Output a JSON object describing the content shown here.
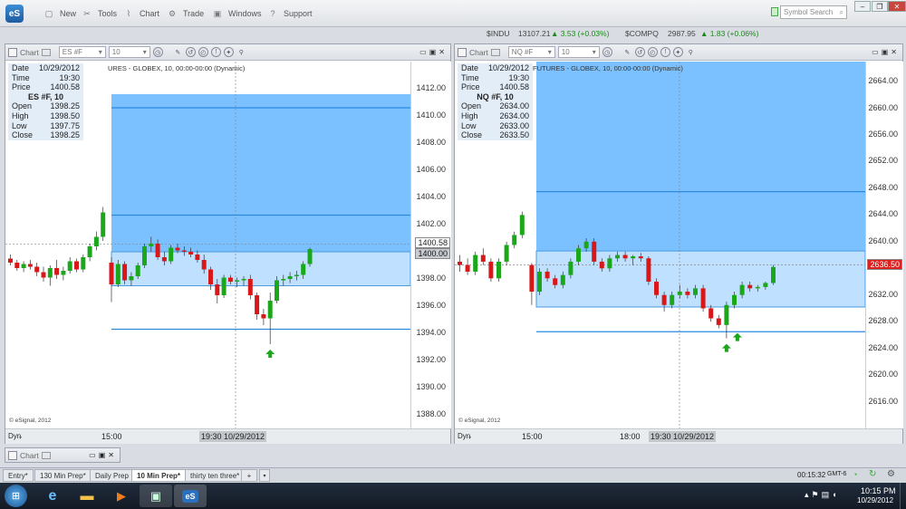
{
  "toolbar": {
    "logo": "eS",
    "items": [
      {
        "label": "New",
        "icon": "new-icon"
      },
      {
        "label": "Tools",
        "icon": "tools-icon"
      },
      {
        "label": "Chart",
        "icon": "chart-icon"
      },
      {
        "label": "Trade",
        "icon": "trade-icon"
      },
      {
        "label": "Windows",
        "icon": "windows-icon"
      },
      {
        "label": "Support",
        "icon": "support-icon"
      }
    ],
    "search_placeholder": "Symbol Search"
  },
  "ticker": [
    {
      "symbol": "$INDU",
      "value": "13107.21",
      "change": "3.53 (+0.03%)"
    },
    {
      "symbol": "$COMPQ",
      "value": "2987.95",
      "change": "1.83 (+0.06%)"
    }
  ],
  "colors": {
    "up": "#1aa81a",
    "down": "#d81818",
    "zone_dark": "#7cc1ff",
    "zone_light": "#bfe0ff"
  },
  "panels": [
    {
      "title": "Chart",
      "symbol": "ES #F",
      "interval": "10",
      "desc": "URES - GLOBEX, 10, 00:00-00:00 (Dynamic)",
      "info": {
        "date_label": "Date",
        "date": "10/29/2012",
        "time_label": "Time",
        "time": "19:30",
        "price_label": "Price",
        "price": "1400.58",
        "symbol_title": "ES #F, 10",
        "open_label": "Open",
        "open": "1398.25",
        "high_label": "High",
        "high": "1398.50",
        "low_label": "Low",
        "low": "1397.75",
        "close_label": "Close",
        "close": "1398.25"
      },
      "yticks": [
        "1412.00",
        "1410.00",
        "1408.00",
        "1406.00",
        "1404.00",
        "1402.00",
        "1400.00",
        "1398.00",
        "1396.00",
        "1394.00",
        "1392.00",
        "1390.00",
        "1388.00"
      ],
      "price_tag": "1400.58",
      "price_tag2": "1400.00",
      "xlabels": [
        "15:00"
      ],
      "cursor_label": "19:30 10/29/2012",
      "footer": "© eSignal, 2012",
      "dyn": "Dyn"
    },
    {
      "title": "Chart",
      "symbol": "NQ #F",
      "interval": "10",
      "desc": "FUTURES - GLOBEX, 10, 00:00-00:00 (Dynamic)",
      "info": {
        "date_label": "Date",
        "date": "10/29/2012",
        "time_label": "Time",
        "time": "19:30",
        "price_label": "Price",
        "price": "1400.58",
        "symbol_title": "NQ #F, 10",
        "open_label": "Open",
        "open": "2634.00",
        "high_label": "High",
        "high": "2634.00",
        "low_label": "Low",
        "low": "2633.00",
        "close_label": "Close",
        "close": "2633.50"
      },
      "yticks": [
        "2664.00",
        "2660.00",
        "2656.00",
        "2652.00",
        "2648.00",
        "2644.00",
        "2640.00",
        "2636.00",
        "2632.00",
        "2628.00",
        "2624.00",
        "2620.00",
        "2616.00"
      ],
      "price_tag": "2636.50",
      "xlabels": [
        "15:00",
        "18:00"
      ],
      "cursor_label": "19:30 10/29/2012",
      "footer": "© eSignal, 2012",
      "dyn": "Dyn"
    }
  ],
  "mini_chart": {
    "title": "Chart"
  },
  "tabs": [
    "Entry*",
    "130 Min Prep*",
    "Daily Prep",
    "10 Min Prep*",
    "thirty ten three*"
  ],
  "active_tab": "10 Min Prep*",
  "status": {
    "clock": "00:15:32",
    "tz": "GMT-6"
  },
  "taskbar": {
    "time": "10:15 PM",
    "date": "10/29/2012"
  },
  "chart_data": [
    {
      "type": "candlestick",
      "symbol": "ES #F",
      "ylim": [
        1387,
        1414
      ],
      "candles": [
        [
          1399.5,
          1399.8,
          1399,
          1399.2
        ],
        [
          1399.2,
          1399.4,
          1398.6,
          1398.8
        ],
        [
          1398.8,
          1399.3,
          1398.5,
          1399.1
        ],
        [
          1399.1,
          1399.4,
          1398.7,
          1398.9
        ],
        [
          1398.9,
          1399.2,
          1398.2,
          1398.5
        ],
        [
          1398.5,
          1398.9,
          1397.8,
          1398.1
        ],
        [
          1398.1,
          1399,
          1397.5,
          1398.8
        ],
        [
          1398.8,
          1399.4,
          1398,
          1398.3
        ],
        [
          1398.3,
          1398.9,
          1397.9,
          1398.6
        ],
        [
          1398.6,
          1399.6,
          1398.4,
          1399.3
        ],
        [
          1399.3,
          1399.5,
          1398.5,
          1398.7
        ],
        [
          1398.7,
          1399.8,
          1398.5,
          1399.6
        ],
        [
          1399.6,
          1400.6,
          1399.3,
          1400.4
        ],
        [
          1400.4,
          1401.5,
          1400.1,
          1401.1
        ],
        [
          1401.1,
          1403.3,
          1400.8,
          1402.9
        ],
        [
          1399.2,
          1399.6,
          1396.3,
          1397.6
        ],
        [
          1397.6,
          1399.4,
          1397.4,
          1399.1
        ],
        [
          1399.1,
          1399.3,
          1397.6,
          1397.9
        ],
        [
          1397.9,
          1398.5,
          1397.5,
          1398.2
        ],
        [
          1398.2,
          1399.2,
          1398,
          1399
        ],
        [
          1399,
          1400.6,
          1398.8,
          1400.4
        ],
        [
          1400.4,
          1401.1,
          1400,
          1400.6
        ],
        [
          1400.6,
          1400.9,
          1399.4,
          1399.6
        ],
        [
          1399.6,
          1400,
          1399,
          1399.3
        ],
        [
          1399.3,
          1400.5,
          1399.1,
          1400.3
        ],
        [
          1400.3,
          1400.6,
          1399.9,
          1400.1
        ],
        [
          1400.1,
          1400.4,
          1399.7,
          1400
        ],
        [
          1400,
          1400.3,
          1399.6,
          1399.8
        ],
        [
          1399.8,
          1400.1,
          1399.2,
          1399.4
        ],
        [
          1399.4,
          1399.8,
          1398.4,
          1398.7
        ],
        [
          1398.7,
          1398.9,
          1397.2,
          1397.6
        ],
        [
          1397.6,
          1398,
          1396.2,
          1396.8
        ],
        [
          1396.8,
          1398.3,
          1396.6,
          1398.1
        ],
        [
          1398.1,
          1398.3,
          1397.6,
          1397.8
        ],
        [
          1397.8,
          1398.1,
          1397.4,
          1397.9
        ],
        [
          1397.9,
          1398.2,
          1397.5,
          1398
        ],
        [
          1398,
          1398.3,
          1396.5,
          1396.8
        ],
        [
          1396.8,
          1397,
          1395,
          1395.4
        ],
        [
          1395.4,
          1395.8,
          1394.6,
          1395.1
        ],
        [
          1395.1,
          1397,
          1393.2,
          1396.4
        ],
        [
          1396.4,
          1398.2,
          1396.2,
          1397.9
        ],
        [
          1397.9,
          1398.3,
          1397.5,
          1398
        ],
        [
          1398,
          1398.5,
          1397.7,
          1398.2
        ],
        [
          1398.2,
          1398.6,
          1397.9,
          1398.3
        ],
        [
          1398.3,
          1399.3,
          1398,
          1399.1
        ],
        [
          1399.1,
          1400.3,
          1398.9,
          1400.2
        ]
      ],
      "zones": [
        {
          "from": 1400,
          "to": 1411.6
        },
        {
          "from": 1397.5,
          "to": 1400
        }
      ],
      "lines": [
        1410.6,
        1402.7,
        1394.3
      ]
    },
    {
      "type": "candlestick",
      "symbol": "NQ #F",
      "ylim": [
        2612,
        2667
      ],
      "candles": [
        [
          2637,
          2638,
          2635.5,
          2636.5
        ],
        [
          2636.5,
          2637.5,
          2635,
          2635.5
        ],
        [
          2635.5,
          2638.5,
          2635,
          2638
        ],
        [
          2638,
          2639,
          2636.5,
          2637
        ],
        [
          2637,
          2637.5,
          2634,
          2634.5
        ],
        [
          2634.5,
          2637.5,
          2634,
          2637
        ],
        [
          2637,
          2640,
          2636.5,
          2639.5
        ],
        [
          2639.5,
          2641.5,
          2639,
          2641
        ],
        [
          2641,
          2644.5,
          2640.5,
          2644
        ],
        [
          2636.5,
          2636.8,
          2630.5,
          2632.5
        ],
        [
          2632.5,
          2636,
          2632,
          2635.5
        ],
        [
          2635.5,
          2636,
          2634,
          2634.5
        ],
        [
          2634.5,
          2635,
          2633,
          2633.5
        ],
        [
          2633.5,
          2635.5,
          2633,
          2635
        ],
        [
          2635,
          2637.5,
          2634.5,
          2637
        ],
        [
          2637,
          2639.5,
          2636.5,
          2639
        ],
        [
          2639,
          2640.5,
          2638.5,
          2640
        ],
        [
          2640,
          2640.5,
          2636.5,
          2637
        ],
        [
          2637,
          2637.5,
          2635.5,
          2636
        ],
        [
          2636,
          2638,
          2635.5,
          2637.5
        ],
        [
          2637.5,
          2638.5,
          2637,
          2638
        ],
        [
          2638,
          2638.5,
          2637,
          2637.5
        ],
        [
          2637.5,
          2638,
          2636.5,
          2637.8
        ],
        [
          2637.8,
          2638.3,
          2637,
          2637.5
        ],
        [
          2637.5,
          2637.8,
          2633.5,
          2634
        ],
        [
          2634,
          2634.5,
          2631.5,
          2632
        ],
        [
          2632,
          2632.5,
          2629.5,
          2630.5
        ],
        [
          2630.5,
          2632.5,
          2630,
          2632
        ],
        [
          2632,
          2633.5,
          2631.5,
          2632.5
        ],
        [
          2632.5,
          2633,
          2631.5,
          2632
        ],
        [
          2632,
          2633.5,
          2631.5,
          2633
        ],
        [
          2633,
          2633.5,
          2629.5,
          2630
        ],
        [
          2630,
          2630.5,
          2628,
          2628.5
        ],
        [
          2628.5,
          2629,
          2627,
          2627.5
        ],
        [
          2627.5,
          2631,
          2625.5,
          2630.5
        ],
        [
          2630.5,
          2632.5,
          2630,
          2632
        ],
        [
          2632,
          2634,
          2631.5,
          2633.5
        ],
        [
          2633.5,
          2634,
          2632.5,
          2633
        ],
        [
          2633,
          2633.5,
          2632.5,
          2633.2
        ],
        [
          2633.2,
          2634,
          2632.8,
          2633.8
        ],
        [
          2633.8,
          2636.5,
          2633.5,
          2636.2
        ]
      ],
      "zones": [
        {
          "from": 2638.6,
          "to": 2667
        },
        {
          "from": 2630.2,
          "to": 2638.6
        }
      ],
      "lines": [
        2647.5,
        2626.5
      ]
    }
  ]
}
